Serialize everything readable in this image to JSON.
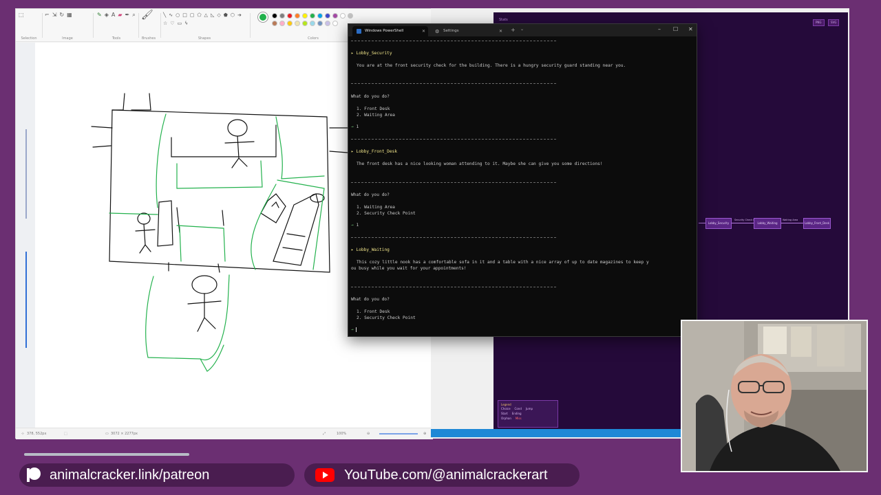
{
  "paint": {
    "ribbon_groups": [
      "Selection",
      "Image",
      "Tools",
      "Brushes",
      "Shapes",
      "Colors"
    ],
    "status_position": "378, 552px",
    "status_size": "3072 × 2277px",
    "zoom": "100%",
    "current_color": "#22b14c",
    "palette": [
      "#000000",
      "#7f7f7f",
      "#ed1c24",
      "#ff7f27",
      "#fff200",
      "#22b14c",
      "#00a2e8",
      "#3f48cc",
      "#a349a4",
      "#ffffff",
      "#c3c3c3",
      "#b97a57",
      "#ffaec9",
      "#ffc90e",
      "#efe4b0",
      "#b5e61d",
      "#99d9ea",
      "#7092be",
      "#c8bfe7",
      "#ffffff"
    ]
  },
  "graph": {
    "stats_label": "Stats",
    "export_png": "PNG",
    "export_svg": "SVG",
    "nodes": [
      "Lobby_Security",
      "Lobby_Waiting",
      "Lobby_Front_Desk"
    ],
    "edge_labels": [
      "Security Check Point",
      "Waiting Area"
    ],
    "legend": {
      "title": "Legend",
      "items": [
        "Choice",
        "Cond",
        "Jump",
        "Start",
        "Ending",
        "Orphan",
        "Miss"
      ]
    }
  },
  "powershell": {
    "tab_active": "Windows PowerShell",
    "tab_inactive": "Settings",
    "blocks": [
      {
        "room": "Lobby_Security",
        "description": "You are at the front security check for the building. There is a hungry security guard standing near you.",
        "question": "What do you do?",
        "options": [
          "1. Front Desk",
          "2. Waiting Area"
        ],
        "input": "1"
      },
      {
        "room": "Lobby_Front_Desk",
        "description": "The front desk has a nice looking woman attending to it. Maybe she can give you some directions!",
        "question": "What do you do?",
        "options": [
          "1. Waiting Area",
          "2. Security Check Point"
        ],
        "input": "1"
      },
      {
        "room": "Lobby_Waiting",
        "description_line1": "This cozy little nook has a comfortable sofa in it and a table with a nice array of up to date magazines to keep y",
        "description_line2": "ou busy while you wait for your appointments!",
        "question": "What do you do?",
        "options": [
          "1. Front Desk",
          "2. Security Check Point"
        ],
        "input": ""
      }
    ],
    "prompt_symbol": "→",
    "room_symbol": "▸"
  },
  "banners": {
    "patreon": "animalcracker.link/patreon",
    "youtube": "YouTube.com/@animalcrackerart"
  }
}
